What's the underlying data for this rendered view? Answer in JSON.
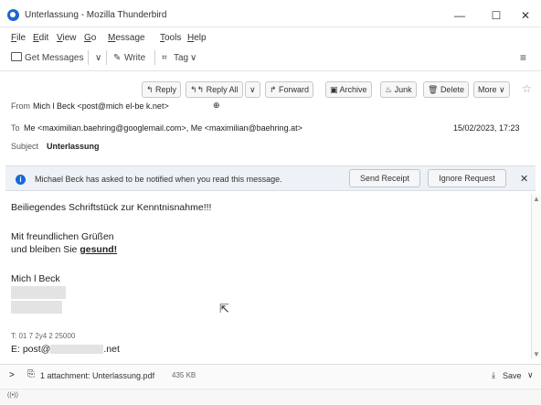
{
  "window": {
    "title": "Unterlassung - Mozilla Thunderbird",
    "minimize": "—",
    "maximize": "☐",
    "close": "✕"
  },
  "menu": {
    "file_first": "F",
    "file_rest": "ile",
    "edit_first": "E",
    "edit_rest": "dit",
    "view_first": "V",
    "view_rest": "iew",
    "go_first": "G",
    "go_rest": "o",
    "message_first": "M",
    "message_rest": "essage",
    "tools_first": "T",
    "tools_rest": "ools",
    "help_first": "H",
    "help_rest": "elp"
  },
  "toolbar": {
    "get_messages": "Get Messages",
    "write": "Write",
    "tag": "Tag",
    "dropdown": "∨",
    "menu_icon": "≡"
  },
  "header": {
    "reply": "Reply",
    "reply_all": "Reply All",
    "forward": "Forward",
    "archive": "Archive",
    "junk": "Junk",
    "delete": "Delete",
    "more": "More",
    "from_label": "From",
    "from_value": "Mich  l Beck <post@mich  el-be  k.net>",
    "to_label": "To",
    "to_value": "Me <maximilian.baehring@googlemail.com>, Me <maximilian@baehring.at>",
    "date": "15/02/2023, 17:23",
    "subject_label": "Subject",
    "subject_value": "Unterlassung"
  },
  "notification": {
    "message": "Michael Beck has asked to be notified when you read this message.",
    "send_receipt": "Send Receipt",
    "ignore_request": "Ignore Request",
    "close": "✕"
  },
  "body": {
    "line1": "Beiliegendes Schriftstück zur Kenntnisnahme!!!",
    "line2": "Mit freundlichen Grüßen",
    "line3_prefix": "und bleiben Sie ",
    "line3_bold": "gesund!",
    "signature_name": "Mich    l Beck",
    "phone": "T: 01 7 2y4 2 25000",
    "email_prefix": "E: post@",
    "email_suffix": ".net"
  },
  "attachments": {
    "expand": ">",
    "label": "1 attachment: Unterlassung.pdf",
    "size": "435 KB",
    "save": "Save",
    "save_dropdown": "∨"
  },
  "status": {
    "icon": "((•))"
  }
}
